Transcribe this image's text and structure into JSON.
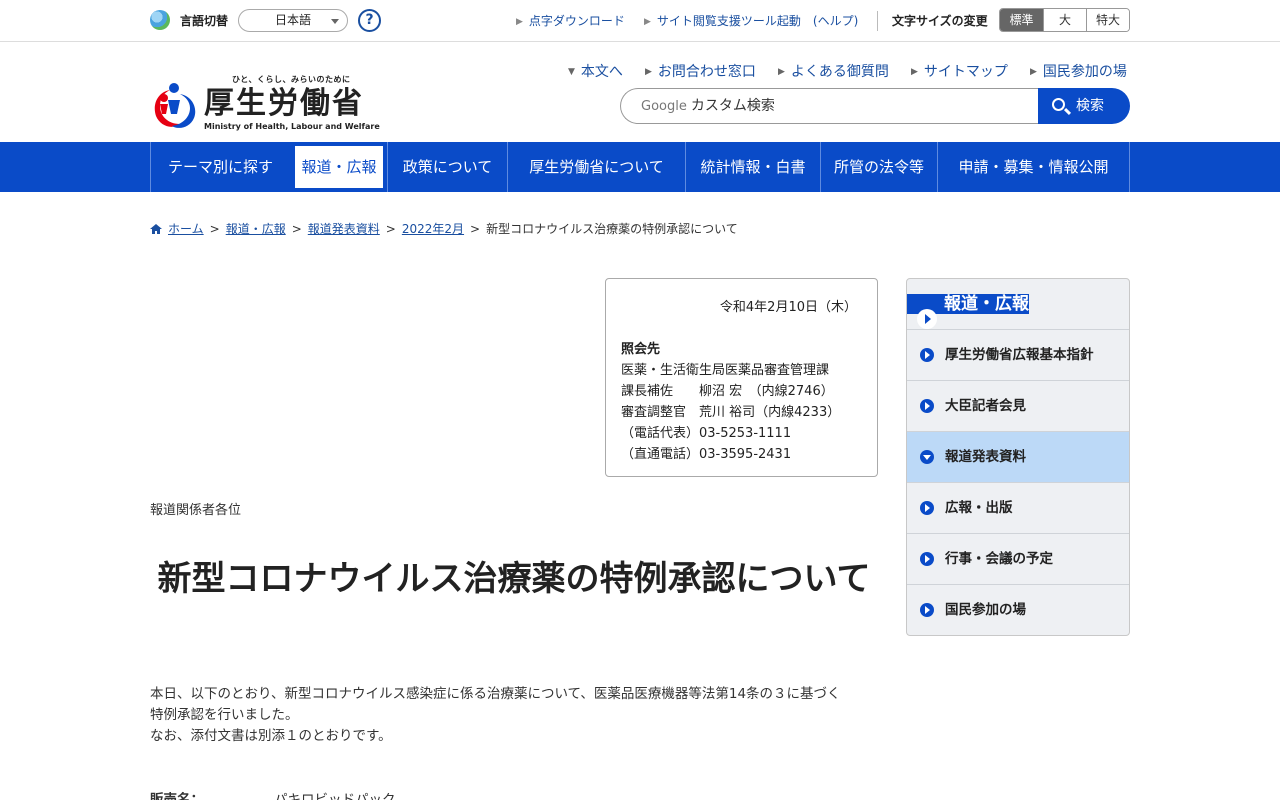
{
  "util": {
    "lang_label": "言語切替",
    "lang_value": "日本語",
    "help": "?",
    "links": [
      "点字ダウンロード",
      "サイト閲覧支援ツール起動　(ヘルプ)"
    ],
    "fontsize_label": "文字サイズの変更",
    "fontsize_options": [
      "標準",
      "大",
      "特大"
    ],
    "fontsize_selected": "標準"
  },
  "logo": {
    "tagline": "ひと、くらし、みらいのために",
    "name": "厚生労働省",
    "english": "Ministry of Health, Labour and Welfare"
  },
  "header_links": [
    "本文へ",
    "お問合わせ窓口",
    "よくある御質問",
    "サイトマップ",
    "国民参加の場"
  ],
  "search": {
    "google": "Google",
    "placeholder": "カスタム検索",
    "button": "検索"
  },
  "nav": [
    "テーマ別に探す",
    "報道・広報",
    "政策について",
    "厚生労働省について",
    "統計情報・白書",
    "所管の法令等",
    "申請・募集・情報公開"
  ],
  "nav_active": "報道・広報",
  "breadcrumb": {
    "items": [
      "ホーム",
      "報道・広報",
      "報道発表資料",
      "2022年2月"
    ],
    "current": "新型コロナウイルス治療薬の特例承認について",
    "separator": ">"
  },
  "contact": {
    "date": "令和4年2月10日（木）",
    "heading": "照会先",
    "lines": [
      "医薬・生活衛生局医薬品審査管理課",
      "課長補佐　　柳沼 宏　（内線2746）",
      "審査調整官　荒川 裕司（内線4233）",
      "（電話代表）03-5253-1111",
      "（直通電話）03-3595-2431"
    ]
  },
  "article": {
    "addressee": "報道関係者各位",
    "title": "新型コロナウイルス治療薬の特例承認について",
    "body": [
      "本日、以下のとおり、新型コロナウイルス感染症に係る治療薬について、医薬品医療機器等法第14条の３に基づく",
      "特例承認を行いました。",
      "なお、添付文書は別添１のとおりです。"
    ],
    "spec_key": "販売名：",
    "spec_value": "パキロビッドパック"
  },
  "sidebar": {
    "heading": "報道・広報",
    "items": [
      "厚生労働省広報基本指針",
      "大臣記者会見",
      "報道発表資料",
      "広報・出版",
      "行事・会議の予定",
      "国民参加の場"
    ],
    "current": "報道発表資料"
  },
  "colors": {
    "primary": "#0a4bc8",
    "link": "#1a4fa0",
    "sidebar_current": "#bcd9f7",
    "logo_red": "#e60012",
    "logo_blue": "#0a4bc8"
  }
}
